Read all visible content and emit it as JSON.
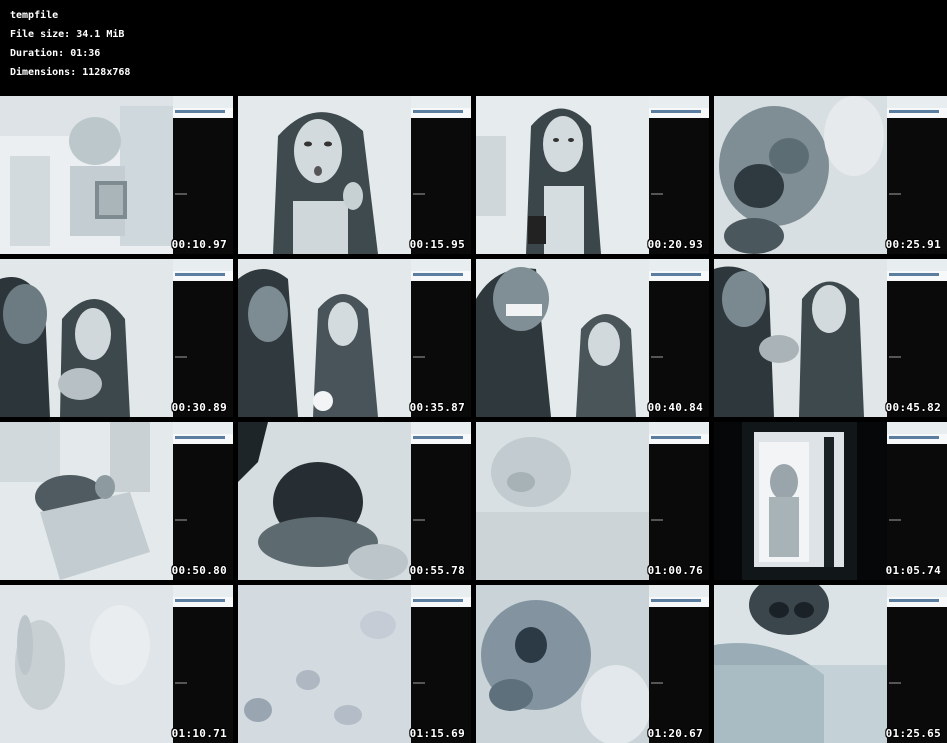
{
  "header": {
    "filename": "tempfile",
    "file_size": "File size: 34.1 MiB",
    "duration": "Duration: 01:36",
    "dimensions": "Dimensions: 1128x768"
  },
  "thumbnails": [
    {
      "timestamp": "00:10.97"
    },
    {
      "timestamp": "00:15.95"
    },
    {
      "timestamp": "00:20.93"
    },
    {
      "timestamp": "00:25.91"
    },
    {
      "timestamp": "00:30.89"
    },
    {
      "timestamp": "00:35.87"
    },
    {
      "timestamp": "00:40.84"
    },
    {
      "timestamp": "00:45.82"
    },
    {
      "timestamp": "00:50.80"
    },
    {
      "timestamp": "00:55.78"
    },
    {
      "timestamp": "01:00.76"
    },
    {
      "timestamp": "01:05.74"
    },
    {
      "timestamp": "01:10.71"
    },
    {
      "timestamp": "01:15.69"
    },
    {
      "timestamp": "01:20.67"
    },
    {
      "timestamp": "01:25.65"
    }
  ]
}
